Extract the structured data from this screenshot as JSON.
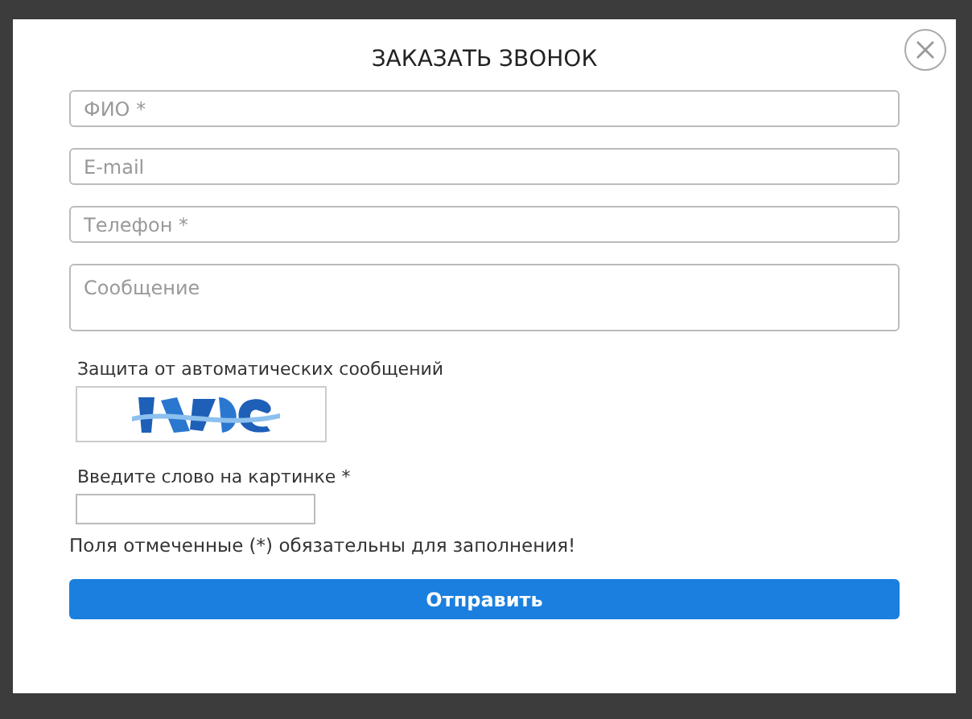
{
  "dialog": {
    "title": "ЗАКАЗАТЬ ЗВОНОК"
  },
  "fields": [
    {
      "kind": "input",
      "placeholder": "ФИО *"
    },
    {
      "kind": "input",
      "placeholder": "E-mail"
    },
    {
      "kind": "input",
      "placeholder": "Телефон *"
    },
    {
      "kind": "textarea",
      "placeholder": "Сообщение"
    }
  ],
  "captcha": {
    "label": "Защита от автоматических сообщений",
    "input_label": "Введите слово на картинке *"
  },
  "note": "Поля отмеченные (*) обязательны для заполнения!",
  "submit_button": "Отправить"
}
